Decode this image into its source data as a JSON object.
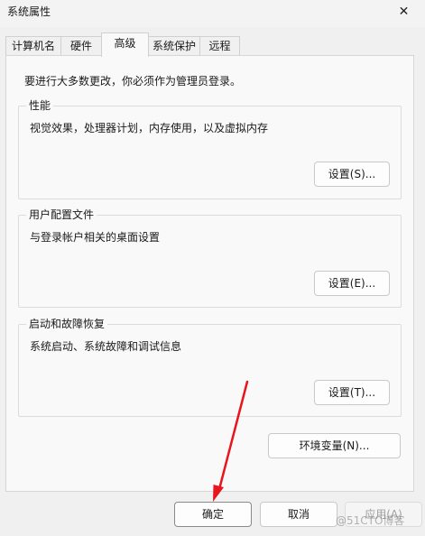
{
  "window": {
    "title": "系统属性",
    "close_label": "✕"
  },
  "tabs": [
    "计算机名",
    "硬件",
    "高级",
    "系统保护",
    "远程"
  ],
  "active_tab": "高级",
  "intro": "要进行大多数更改，你必须作为管理员登录。",
  "groups": {
    "performance": {
      "title": "性能",
      "desc": "视觉效果，处理器计划，内存使用，以及虚拟内存",
      "button": "设置(S)..."
    },
    "user_profiles": {
      "title": "用户配置文件",
      "desc": "与登录帐户相关的桌面设置",
      "button": "设置(E)..."
    },
    "startup_recovery": {
      "title": "启动和故障恢复",
      "desc": "系统启动、系统故障和调试信息",
      "button": "设置(T)..."
    }
  },
  "env_button": "环境变量(N)...",
  "footer": {
    "ok": "确定",
    "cancel": "取消",
    "apply": "应用(A)"
  },
  "watermark": "@51CTO博客",
  "annotation_color": "#e8141e"
}
